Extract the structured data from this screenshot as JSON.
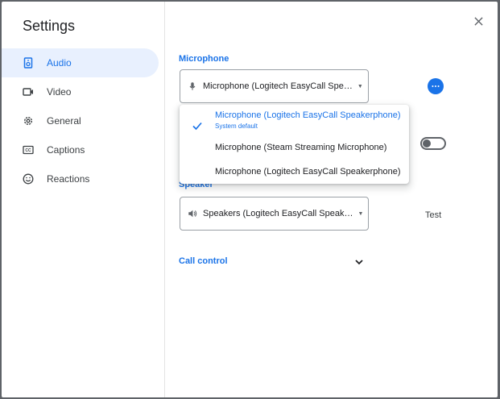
{
  "sidebar": {
    "title": "Settings",
    "items": [
      {
        "label": "Audio",
        "icon": "audio-icon",
        "active": true
      },
      {
        "label": "Video",
        "icon": "video-icon"
      },
      {
        "label": "General",
        "icon": "gear-icon"
      },
      {
        "label": "Captions",
        "icon": "captions-icon"
      },
      {
        "label": "Reactions",
        "icon": "smiley-icon"
      }
    ]
  },
  "microphone": {
    "label": "Microphone",
    "selected": "Microphone (Logitech EasyCall Spe…",
    "options": [
      {
        "label": "Microphone (Logitech EasyCall Speakerphone)",
        "sub": "System default",
        "selected": true
      },
      {
        "label": "Microphone (Steam Streaming Microphone)"
      },
      {
        "label": "Microphone (Logitech EasyCall Speakerphone)"
      }
    ]
  },
  "speaker": {
    "label": "Speaker",
    "selected": "Speakers (Logitech EasyCall Speak…",
    "test_label": "Test"
  },
  "call_control": {
    "label": "Call control"
  },
  "colors": {
    "accent": "#1a73e8",
    "active_bg": "#e8f0fe"
  }
}
